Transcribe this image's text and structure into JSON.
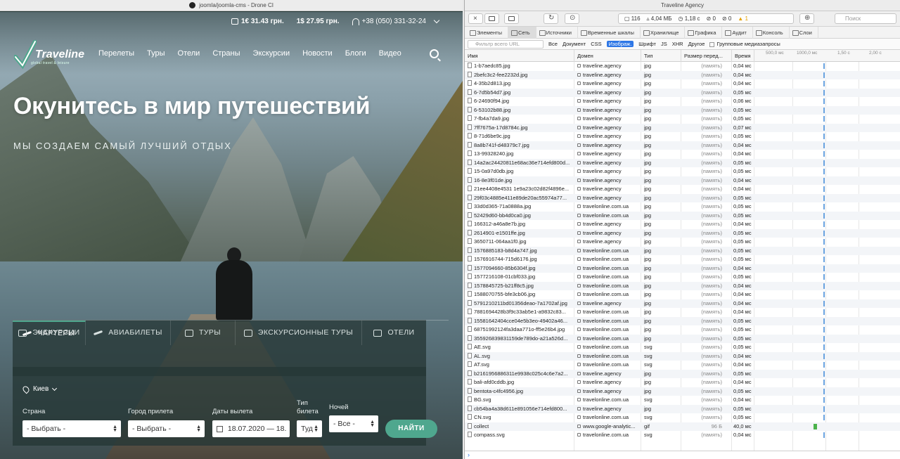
{
  "left_window": {
    "title": "joomla/joomla-cms - Drone CI",
    "topbar": {
      "eur_rate": "1€ 31.43 грн.",
      "usd_rate": "1$ 27.95 грн.",
      "phone": "+38 (050) 331-32-24"
    },
    "logo": {
      "name": "Traveline",
      "tagline": "global travel & leisure"
    },
    "nav": [
      "Перелеты",
      "Туры",
      "Отели",
      "Страны",
      "Экскурсии",
      "Новости",
      "Блоги",
      "Видео"
    ],
    "headline": "Окунитесь в мир путешествий",
    "subline": "Мы создаем самый лучший отдых",
    "tabs": {
      "row1": [
        "Чартеры",
        "Авиабилеты",
        "Туры",
        "Экскурсионные туры",
        "Отели"
      ],
      "row2": [
        "Экскурсии"
      ],
      "active": "Чартеры"
    },
    "form": {
      "city": "Киев",
      "country_label": "Страна",
      "country_value": "- Выбрать -",
      "arrival_label": "Город прилета",
      "arrival_value": "- Выбрать -",
      "dates_label": "Даты вылета",
      "dates_value": "18.07.2020 — 18.",
      "ticket_label_1": "Тип",
      "ticket_label_2": "билета",
      "ticket_value": "Туд",
      "nights_label": "Ночей",
      "nights_value": "- Все -",
      "find_button": "НАЙТИ"
    },
    "colors": {
      "accent": "#4fa78e"
    }
  },
  "devtools": {
    "title": "Traveline Agency",
    "stats": {
      "count": "116",
      "size": "4,04 МБ",
      "time": "1,18 с",
      "errors": "0",
      "warnings_a": "0",
      "warnings_b": "1"
    },
    "search_placeholder": "Поиск",
    "tabs": [
      "Элементы",
      "Сеть",
      "Источники",
      "Временные шкалы",
      "Хранилище",
      "Графика",
      "Аудит",
      "Консоль",
      "Слои"
    ],
    "active_tab": "Сеть",
    "filter": {
      "placeholder": "Фильтр всего URL",
      "types": [
        "Все",
        "Документ",
        "CSS",
        "Изображ.",
        "Шрифт",
        "JS",
        "XHR",
        "Другое"
      ],
      "active_type": "Изображ.",
      "group_label": "Групповые медиазапросы"
    },
    "columns": {
      "name": "Имя",
      "domain": "Домен",
      "type": "Тип",
      "size": "Размер перед...",
      "time": "Время"
    },
    "ticks": [
      "500,0 мс",
      "1000,0 мс",
      "1,50 с",
      "2,00 с"
    ],
    "rows": [
      [
        "1-b7aedc85.jpg",
        "traveline.agency",
        "jpg",
        "(память)",
        "0,04 мс"
      ],
      [
        "2befc3c2-fee2232d.jpg",
        "traveline.agency",
        "jpg",
        "(память)",
        "0,04 мс"
      ],
      [
        "4-35b2d813.jpg",
        "traveline.agency",
        "jpg",
        "(память)",
        "0,04 мс"
      ],
      [
        "6-7d5b54d7.jpg",
        "traveline.agency",
        "jpg",
        "(память)",
        "0,05 мс"
      ],
      [
        "6-24690f94.jpg",
        "traveline.agency",
        "jpg",
        "(память)",
        "0,06 мс"
      ],
      [
        "6-53102b88.jpg",
        "traveline.agency",
        "jpg",
        "(память)",
        "0,05 мс"
      ],
      [
        "7-fb4a7da9.jpg",
        "traveline.agency",
        "jpg",
        "(память)",
        "0,05 мс"
      ],
      [
        "7ff7675a-17d8784c.jpg",
        "traveline.agency",
        "jpg",
        "(память)",
        "0,07 мс"
      ],
      [
        "8-71d6be9c.jpg",
        "traveline.agency",
        "jpg",
        "(память)",
        "0,05 мс"
      ],
      [
        "8a8b741f-d48379c7.jpg",
        "traveline.agency",
        "jpg",
        "(память)",
        "0,04 мс"
      ],
      [
        "13-99328240.jpg",
        "traveline.agency",
        "jpg",
        "(память)",
        "0,04 мс"
      ],
      [
        "14a2ac24420811e68ac36e714efd800d...",
        "traveline.agency",
        "jpg",
        "(память)",
        "0,05 мс"
      ],
      [
        "15-0a97d0db.jpg",
        "traveline.agency",
        "jpg",
        "(память)",
        "0,05 мс"
      ],
      [
        "16-8e3f01de.jpg",
        "traveline.agency",
        "jpg",
        "(память)",
        "0,04 мс"
      ],
      [
        "21ee4408e4531 1e9a23c02d82f4896e...",
        "traveline.agency",
        "jpg",
        "(память)",
        "0,04 мс"
      ],
      [
        "29f03c4885e411e89de20ac55974a77...",
        "traveline.agency",
        "jpg",
        "(память)",
        "0,05 мс"
      ],
      [
        "33d0d365-71a0888a.jpg",
        "travelonline.com.ua",
        "jpg",
        "(память)",
        "0,05 мс"
      ],
      [
        "52429d60-bb4d0ca0.jpg",
        "travelonline.com.ua",
        "jpg",
        "(память)",
        "0,05 мс"
      ],
      [
        "166312-a46a8e7b.jpg",
        "traveline.agency",
        "jpg",
        "(память)",
        "0,04 мс"
      ],
      [
        "2614901-e1501ffe.jpg",
        "traveline.agency",
        "jpg",
        "(память)",
        "0,05 мс"
      ],
      [
        "3650711-064aa1f0.jpg",
        "traveline.agency",
        "jpg",
        "(память)",
        "0,05 мс"
      ],
      [
        "1576885183-b8d4a747.jpg",
        "travelonline.com.ua",
        "jpg",
        "(память)",
        "0,05 мс"
      ],
      [
        "1576916744-715d6176.jpg",
        "travelonline.com.ua",
        "jpg",
        "(память)",
        "0,05 мс"
      ],
      [
        "1577094660-85b6304f.jpg",
        "travelonline.com.ua",
        "jpg",
        "(память)",
        "0,04 мс"
      ],
      [
        "1577216108-01cbf033.jpg",
        "travelonline.com.ua",
        "jpg",
        "(память)",
        "0,05 мс"
      ],
      [
        "1578845725-b21ff8c5.jpg",
        "travelonline.com.ua",
        "jpg",
        "(память)",
        "0,04 мс"
      ],
      [
        "1588070755-bfe3cb06.jpg",
        "travelonline.com.ua",
        "jpg",
        "(память)",
        "0,04 мс"
      ],
      [
        "5791210211bd01356deao-7a1702af.jpg",
        "traveline.agency",
        "jpg",
        "(память)",
        "0,04 мс"
      ],
      [
        "7881694428b3f9c33ab5e1-a9832c83...",
        "travelonline.com.ua",
        "jpg",
        "(память)",
        "0,04 мс"
      ],
      [
        "15581642404cce04e5b3eo-49402a46...",
        "travelonline.com.ua",
        "jpg",
        "(память)",
        "0,05 мс"
      ],
      [
        "68751992124fa3daa771o-ff5e26b4.jpg",
        "travelonline.com.ua",
        "jpg",
        "(память)",
        "0,05 мс"
      ],
      [
        "355926839831159de789do-a21a526d...",
        "travelonline.com.ua",
        "jpg",
        "(память)",
        "0,05 мс"
      ],
      [
        "AE.svg",
        "travelonline.com.ua",
        "svg",
        "(память)",
        "0,05 мс"
      ],
      [
        "AL.svg",
        "travelonline.com.ua",
        "svg",
        "(память)",
        "0,04 мс"
      ],
      [
        "AT.svg",
        "travelonline.com.ua",
        "svg",
        "(память)",
        "0,04 мс"
      ],
      [
        "b2161956886311e9938c025c4c6e7a2...",
        "traveline.agency",
        "jpg",
        "(память)",
        "0,05 мс"
      ],
      [
        "bali-afd0cddb.jpg",
        "traveline.agency",
        "jpg",
        "(память)",
        "0,04 мс"
      ],
      [
        "bentota-c4fc4956.jpg",
        "traveline.agency",
        "jpg",
        "(память)",
        "0,05 мс"
      ],
      [
        "BG.svg",
        "travelonline.com.ua",
        "svg",
        "(память)",
        "0,04 мс"
      ],
      [
        "cb54ba4a38d611e891056e714efd800...",
        "traveline.agency",
        "jpg",
        "(память)",
        "0,05 мс"
      ],
      [
        "CN.svg",
        "travelonline.com.ua",
        "svg",
        "(память)",
        "0,05 мс"
      ],
      [
        "collect",
        "www.google-analytic...",
        "gif",
        "96 Б",
        "40,0 мс"
      ],
      [
        "compass.svg",
        "travelonline.com.ua",
        "svg",
        "(память)",
        "0,04 мс"
      ]
    ]
  }
}
